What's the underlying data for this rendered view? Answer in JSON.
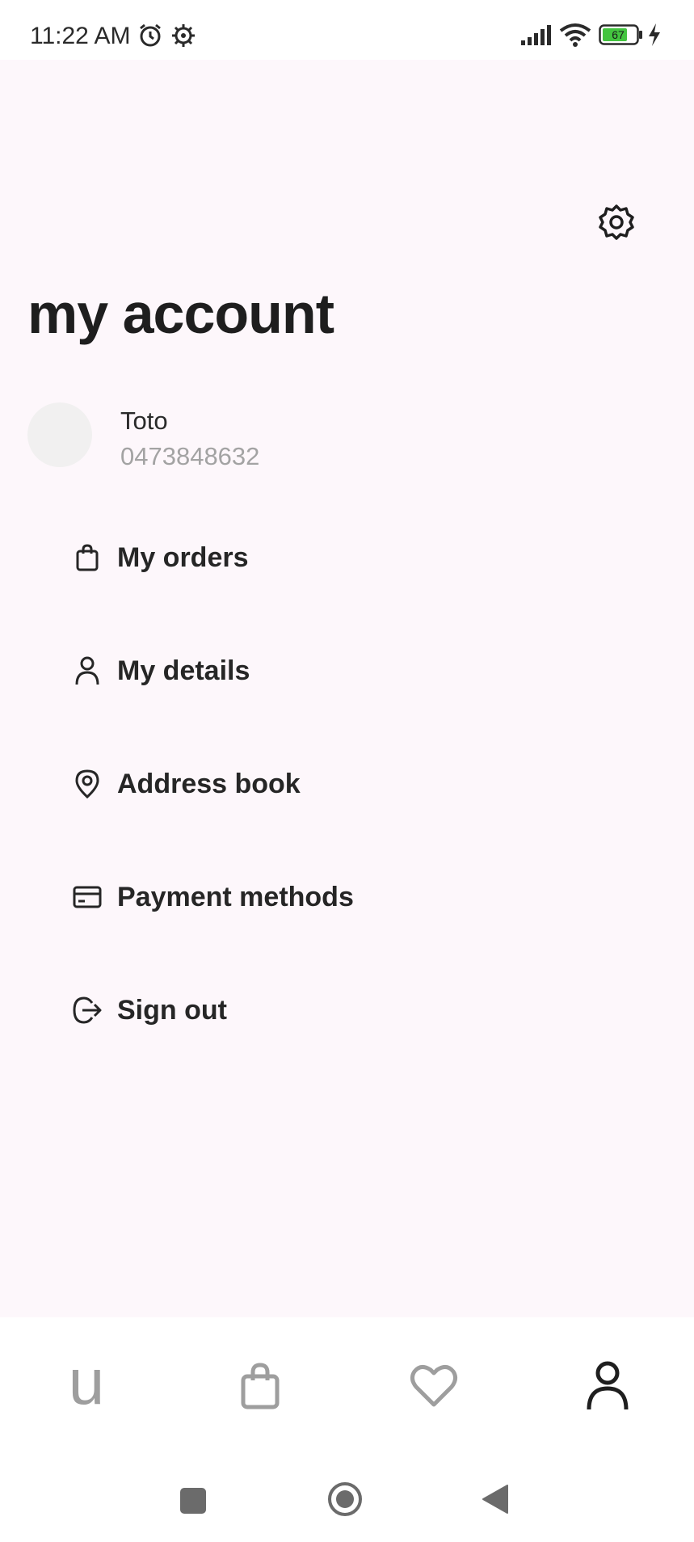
{
  "status_bar": {
    "time": "11:22 AM",
    "battery": "67",
    "icons": [
      "alarm-icon",
      "settings-status-icon",
      "signal-icon",
      "wifi-icon",
      "battery-icon",
      "charging-icon"
    ]
  },
  "header": {
    "title": "my account",
    "settings_icon": "gear-icon"
  },
  "profile": {
    "name": "Toto",
    "phone": "0473848632"
  },
  "menu": {
    "items": [
      {
        "label": "My orders",
        "icon": "shopping-bag-icon"
      },
      {
        "label": "My details",
        "icon": "person-icon"
      },
      {
        "label": "Address book",
        "icon": "location-pin-icon"
      },
      {
        "label": "Payment methods",
        "icon": "credit-card-icon"
      },
      {
        "label": "Sign out",
        "icon": "sign-out-icon"
      }
    ]
  },
  "bottom_nav": {
    "home_logo": "u",
    "items": [
      "home-logo",
      "bag-icon",
      "heart-icon",
      "person-icon"
    ],
    "active": "account",
    "colors": {
      "active": "#1f1f1f",
      "inactive": "#9e9e9e"
    }
  },
  "system_nav": [
    "recents-square-icon",
    "home-circle-icon",
    "back-triangle-icon"
  ]
}
